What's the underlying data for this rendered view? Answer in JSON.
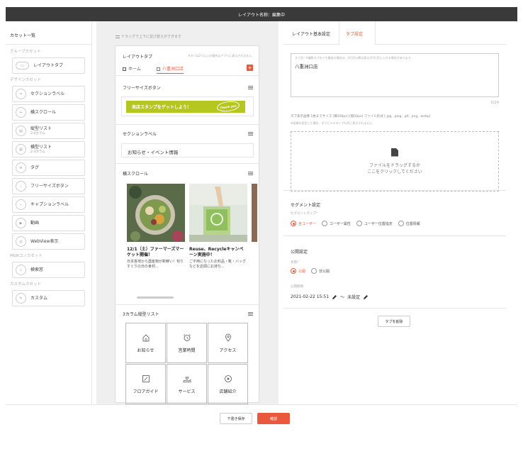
{
  "header": {
    "title": "レイアウト名称：編集中"
  },
  "palette": {
    "title": "カセット一覧",
    "sections": [
      {
        "title": "グループカセット",
        "items": [
          {
            "label": "レイアウトタブ",
            "sub": ""
          }
        ]
      },
      {
        "title": "デザインカセット",
        "items": [
          {
            "label": "セクションラベル",
            "sub": ""
          },
          {
            "label": "横スクロール",
            "sub": ""
          },
          {
            "label": "縦型リスト",
            "sub": "2-4カラム"
          },
          {
            "label": "横型リスト",
            "sub": "2-3カラム"
          },
          {
            "label": "タグ",
            "sub": ""
          },
          {
            "label": "フリーサイズボタン",
            "sub": ""
          },
          {
            "label": "キャプションラベル",
            "sub": ""
          },
          {
            "label": "動画",
            "sub": ""
          },
          {
            "label": "WebView表示",
            "sub": ""
          }
        ]
      },
      {
        "title": "MGRコノカセット",
        "items": [
          {
            "label": "検索窓",
            "sub": ""
          }
        ]
      },
      {
        "title": "カスタムカセット",
        "items": [
          {
            "label": "カスタム",
            "sub": ""
          }
        ]
      }
    ]
  },
  "center": {
    "drag_hint": "ドラッグで上下に並び替えができます",
    "layout_tab": {
      "title": "レイアウトタブ",
      "note": "※タブは2つ以上の場合はアプリに表示されません",
      "tabs": [
        "ホーム",
        "八重洲口店"
      ],
      "add": "+"
    },
    "free_button": {
      "title": "フリーサイズボタン",
      "label": "来店スタンプをゲットしよう！",
      "badge": "Thank you"
    },
    "section_label": {
      "title": "セクションラベル",
      "value": "お知らせ・イベント情報"
    },
    "h_scroll": {
      "title": "横スクロール",
      "cards": [
        {
          "title": "12/1（土）ファーマーズマーケット開催！",
          "desc": "日本各地から農産物が新鮮い！旬りすぐりの日の食材..."
        },
        {
          "title": "Reuse、Recycleキャンペーン実施中！",
          "desc": "ご不用になったお料品・靴・バッグなどを店頭にお持ち..."
        }
      ]
    },
    "grid": {
      "title": "3カラム縦型リスト",
      "items": [
        {
          "label": "お知らせ",
          "icon": "home-icon"
        },
        {
          "label": "営業時間",
          "icon": "alarm-icon"
        },
        {
          "label": "アクセス",
          "icon": "location-icon"
        },
        {
          "label": "フロアガイド",
          "icon": "edit-icon"
        },
        {
          "label": "サービス",
          "icon": "hand-heart-icon"
        },
        {
          "label": "店舗紹介",
          "icon": "play-icon"
        }
      ]
    }
  },
  "right": {
    "tabs": [
      "レイアウト基本設定",
      "タブ設定"
    ],
    "tab_name": {
      "hint": "タブ名* ※複数タブのうち最長の場合は、2行目以降は表示が2行目に入れる場合があります",
      "value": "八重洲口店",
      "counter": "0/24"
    },
    "image": {
      "hint1": "タブ表示画像 1枚までサイズ [横200px] [縦50px] ファイル形式 [.jpg, .jpeg, .gif, .png, .webp]",
      "hint2": "※画像を設定した場合、タブにテキストでも同じ表示されません",
      "drop": [
        "ファイルをドラッグするか",
        "ここをクリックしてください"
      ]
    },
    "segment": {
      "title": "セグメント設定",
      "sub": "セグメントタイプ*",
      "options": [
        "全ユーザー",
        "ユーザー属性",
        "ユーザー位置指定",
        "位置情報"
      ]
    },
    "publish": {
      "title": "公開設定",
      "sub": "状態*",
      "options": [
        "公開",
        "非公開"
      ],
      "period_label": "公開期間",
      "start": "2021-02-22 15:51",
      "tilde": "〜",
      "end": "未設定"
    },
    "delete": "タブを削除"
  },
  "footer": {
    "draft": "下書き保存",
    "confirm": "確認"
  },
  "colors": {
    "accent": "#e85a3b",
    "button_green": "#b5c620",
    "topbar": "#3a3a3a"
  }
}
